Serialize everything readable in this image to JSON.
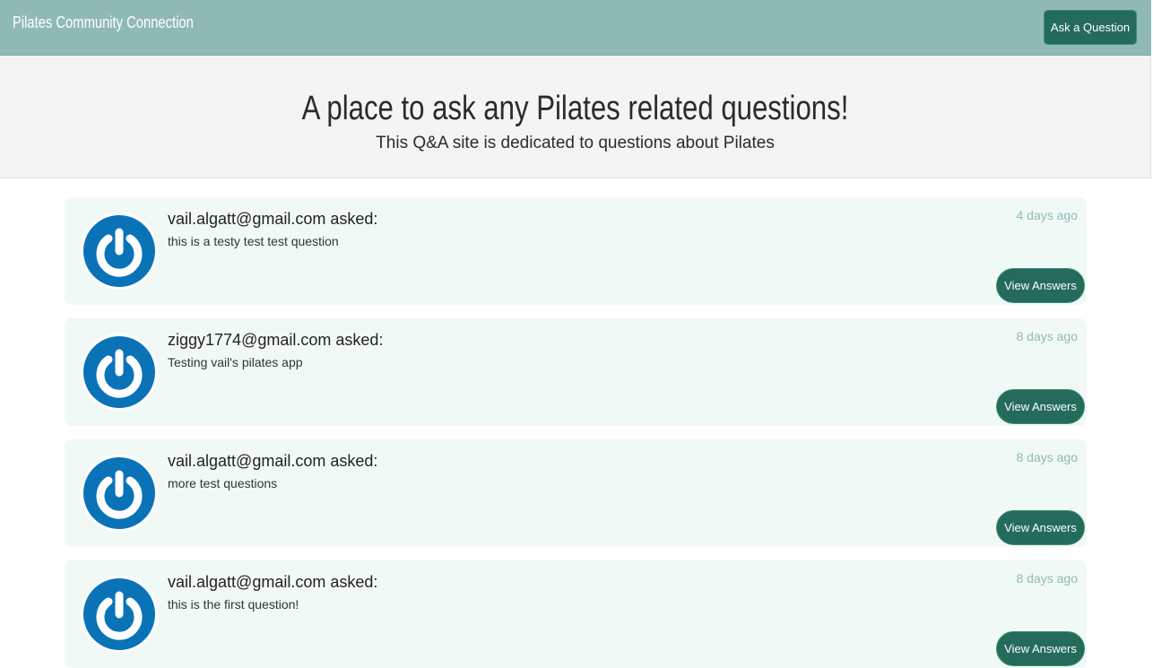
{
  "navbar": {
    "brand": "Pilates Community Connection",
    "ask_button": "Ask a Question"
  },
  "hero": {
    "title": "A place to ask any Pilates related questions!",
    "subtitle": "This Q&A site is dedicated to questions about Pilates"
  },
  "questions": [
    {
      "asker": "vail.algatt@gmail.com asked:",
      "text": "this is a testy test test question",
      "time": "4 days ago",
      "button": "View Answers"
    },
    {
      "asker": "ziggy1774@gmail.com asked:",
      "text": "Testing vail's pilates app",
      "time": "8 days ago",
      "button": "View Answers"
    },
    {
      "asker": "vail.algatt@gmail.com asked:",
      "text": "more test questions",
      "time": "8 days ago",
      "button": "View Answers"
    },
    {
      "asker": "vail.algatt@gmail.com asked:",
      "text": "this is the first question!",
      "time": "8 days ago",
      "button": "View Answers"
    }
  ],
  "colors": {
    "navbar": "#8fbab4",
    "button": "#246b5b",
    "card": "#f1f9f7",
    "avatar_blue": "#0a73b8"
  },
  "icons": {
    "avatar": "power-icon"
  }
}
